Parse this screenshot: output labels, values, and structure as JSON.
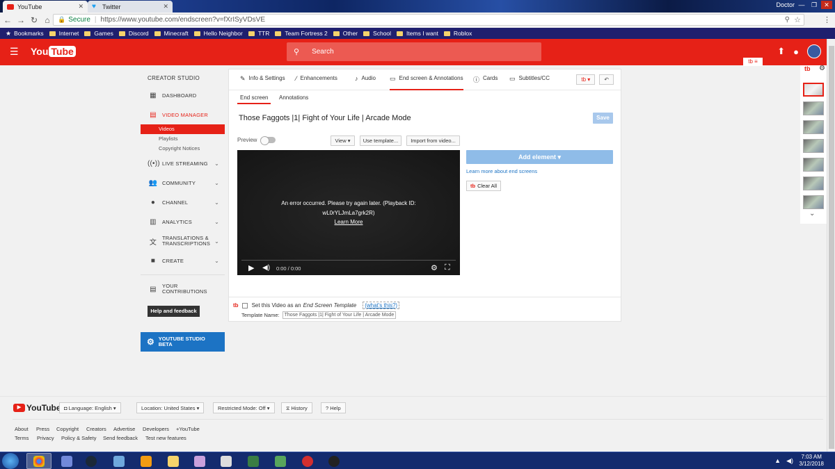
{
  "browser": {
    "tabs": [
      {
        "label": "YouTube",
        "active": true
      },
      {
        "label": "Twitter",
        "active": false
      }
    ],
    "window_user": "Doctor",
    "url_secure": "Secure",
    "url": "https://www.youtube.com/endscreen?v=fXrISyVDsVE",
    "bookmarks": [
      "Bookmarks",
      "Internet",
      "Games",
      "Discord",
      "Minecraft",
      "Hello Neighbor",
      "TTR",
      "Team Fortress 2",
      "Other",
      "School",
      "Items I want",
      "Roblox"
    ]
  },
  "header": {
    "logo_you": "You",
    "logo_tube": "Tube",
    "search_placeholder": "Search"
  },
  "sidebar": {
    "title": "CREATOR STUDIO",
    "dashboard": "DASHBOARD",
    "video_manager": "VIDEO MANAGER",
    "vm_sub": [
      "Videos",
      "Playlists",
      "Copyright Notices"
    ],
    "items": [
      "LIVE STREAMING",
      "COMMUNITY",
      "CHANNEL",
      "ANALYTICS",
      "TRANSLATIONS & TRANSCRIPTIONS",
      "CREATE"
    ],
    "your_contrib": "YOUR CONTRIBUTIONS",
    "help": "Help and feedback",
    "studio_beta": "YOUTUBE STUDIO BETA"
  },
  "editor": {
    "tabs": [
      "Info & Settings",
      "Enhancements",
      "Audio",
      "End screen & Annotations",
      "Cards",
      "Subtitles/CC"
    ],
    "subtabs": [
      "End screen",
      "Annotations"
    ],
    "video_title": "Those Faggots |1| Fight of Your Life | Arcade Mode",
    "save": "Save",
    "preview": "Preview",
    "view": "View",
    "use_template": "Use template...",
    "import": "Import from video...",
    "error_line1": "An error occurred. Please try again later. (Playback ID:",
    "error_line2": "wL0rYLJmLa7grk2R)",
    "learn_more": "Learn More",
    "time": "0:00 / 0:00",
    "add_element": "Add element",
    "learn_end": "Learn more about end screens",
    "clear_all": "Clear All",
    "set_template_a": "Set this Video as an",
    "set_template_b": "End Screen Template",
    "whats_this": "(what's this?)",
    "template_name_label": "Template Name:",
    "template_name_value": "Those Faggots |1| Fight of Your Life | Arcade Mode"
  },
  "footer": {
    "logo": "YouTube",
    "language": "Language: English",
    "location": "Location: United States",
    "restricted": "Restricted Mode: Off",
    "history": "History",
    "help": "Help",
    "links_row1": [
      "About",
      "Press",
      "Copyright",
      "Creators",
      "Advertise",
      "Developers",
      "+YouTube"
    ],
    "links_row2": [
      "Terms",
      "Privacy",
      "Policy & Safety",
      "Send feedback",
      "Test new features"
    ]
  },
  "taskbar": {
    "time": "7:03 AM",
    "date": "3/12/2018"
  }
}
